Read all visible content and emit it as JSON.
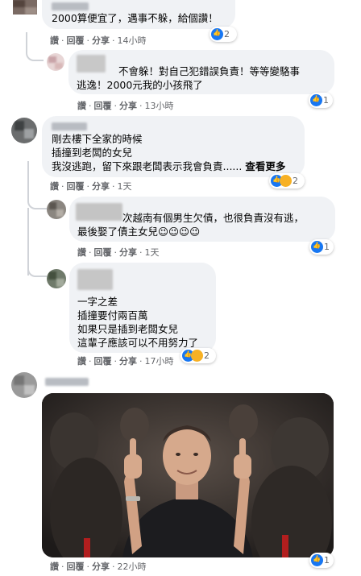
{
  "comments": [
    {
      "text": [
        "2000算便宜了，遇事不躲，給個讚！"
      ],
      "actions": {
        "like": "讚",
        "reply": "回覆",
        "share": "分享",
        "time": "14小時"
      },
      "reaction_count": "2"
    },
    {
      "text": [
        "不會躲！對自己犯錯誤負責！等等變駱事",
        "逃逸！2000元我的小孩飛了"
      ],
      "actions": {
        "like": "讚",
        "reply": "回覆",
        "share": "分享",
        "time": "13小時"
      },
      "reaction_count": "1"
    },
    {
      "text": [
        "剛去樓下全家的時候",
        "插撞到老闆的女兒",
        "我沒逃跑，留下來跟老闆表示我會負責......"
      ],
      "see_more": "查看更多",
      "actions": {
        "like": "讚",
        "reply": "回覆",
        "share": "分享",
        "time": "1天"
      },
      "reaction_count": "2"
    },
    {
      "text": [
        "次越南有個男生欠債，也很負責沒有逃，",
        "最後娶了債主女兒😉😉😉😉"
      ],
      "actions": {
        "like": "讚",
        "reply": "回覆",
        "share": "分享",
        "time": "1天"
      },
      "reaction_count": "1"
    },
    {
      "text": [
        "一字之差",
        "插撞要付兩百萬",
        "如果只是插到老闆女兒",
        "這輩子應該可以不用努力了"
      ],
      "actions": {
        "like": "讚",
        "reply": "回覆",
        "share": "分享",
        "time": "17小時"
      },
      "reaction_count": "2"
    },
    {
      "actions": {
        "like": "讚",
        "reply": "回覆",
        "share": "分享",
        "time": "22小時"
      },
      "reaction_count": "1"
    }
  ],
  "colors": {
    "bubble": "#f0f2f5",
    "meta": "#65676b",
    "like_blue": "#1877f2"
  },
  "icons": [
    "like-reaction-icon",
    "haha-reaction-icon",
    "wow-reaction-icon"
  ]
}
